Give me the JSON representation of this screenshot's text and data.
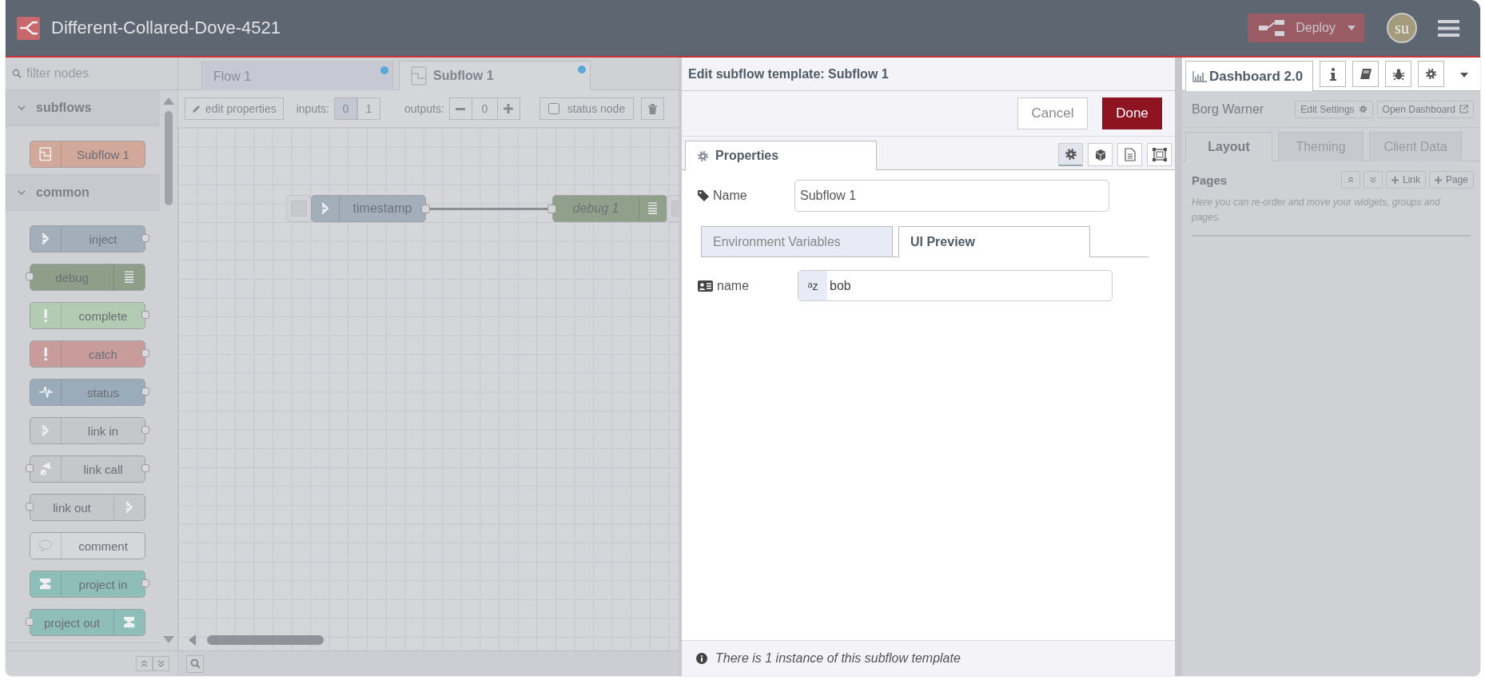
{
  "header": {
    "title": "Different-Collared-Dove-4521",
    "deploy": "Deploy",
    "user": "su"
  },
  "palette": {
    "filter": {
      "placeholder": "filter nodes"
    },
    "categories": [
      {
        "label": "subflows",
        "expanded": true,
        "nodes": [
          {
            "kind": "subflow",
            "label": "Subflow 1",
            "color": "#d2a89a",
            "input": false,
            "output": false
          }
        ]
      },
      {
        "label": "common",
        "expanded": true,
        "nodes": [
          {
            "kind": "inject",
            "label": "inject",
            "color": "#a3aebb",
            "input": false,
            "output": true
          },
          {
            "kind": "debug",
            "label": "debug",
            "color": "#8e9e89",
            "input": true,
            "output": false
          },
          {
            "kind": "complete",
            "label": "complete",
            "color": "#b4cbb3",
            "input": false,
            "output": true
          },
          {
            "kind": "catch",
            "label": "catch",
            "color": "#c99c9c",
            "input": false,
            "output": true
          },
          {
            "kind": "status",
            "label": "status",
            "color": "#9aabb9",
            "input": false,
            "output": true
          },
          {
            "kind": "linkin",
            "label": "link in",
            "color": "#c6c7cb",
            "input": false,
            "output": true
          },
          {
            "kind": "linkcall",
            "label": "link call",
            "color": "#c6c7cb",
            "input": true,
            "output": true
          },
          {
            "kind": "linkout",
            "label": "link out",
            "color": "#c6c7cb",
            "input": true,
            "output": false
          },
          {
            "kind": "comment",
            "label": "comment",
            "color": "#d6d7db",
            "input": false,
            "output": false
          },
          {
            "kind": "projectin",
            "label": "project in",
            "color": "#8fbdb8",
            "input": false,
            "output": true
          },
          {
            "kind": "projectout",
            "label": "project out",
            "color": "#8fbdb8",
            "input": true,
            "output": false
          }
        ]
      }
    ]
  },
  "workspace": {
    "tabs": [
      {
        "kind": "flow",
        "label": "Flow 1",
        "selected": false,
        "changed": true
      },
      {
        "kind": "subflow",
        "label": "Subflow 1",
        "selected": true,
        "changed": true
      }
    ],
    "toolbar": {
      "edit_button": "edit properties",
      "inputs_label": "inputs:",
      "inputs": [
        {
          "label": "0",
          "selected": true
        },
        {
          "label": "1",
          "selected": false
        }
      ],
      "outputs_label": "outputs:",
      "outputs_value": "0",
      "status_node": {
        "label": "status node",
        "checked": false
      }
    },
    "nodes": [
      {
        "kind": "inject",
        "label": "timestamp",
        "italic": false
      },
      {
        "kind": "debug",
        "label": "debug 1",
        "italic": true
      }
    ]
  },
  "tray": {
    "title": "Edit subflow template: Subflow 1",
    "cancel": "Cancel",
    "done": "Done",
    "tabs": [
      {
        "label": "Properties",
        "selected": true
      }
    ],
    "tab_icons": [
      {
        "kind": "settings",
        "selected": true
      },
      {
        "kind": "appearance",
        "selected": false
      },
      {
        "kind": "description",
        "selected": false
      },
      {
        "kind": "frame",
        "selected": false
      }
    ],
    "name_field": {
      "label": "Name",
      "value": "Subflow 1"
    },
    "subtabs": [
      {
        "label": "Environment Variables",
        "selected": false
      },
      {
        "label": "UI Preview",
        "selected": true
      }
    ],
    "preview_fields": [
      {
        "label": "name",
        "type_label": "$^{a}$z",
        "value": "bob"
      }
    ],
    "footer": "There is 1 instance of this subflow template"
  },
  "sidebar": {
    "tabs": [
      {
        "label": "Dashboard 2.0",
        "selected": true
      }
    ],
    "tab_icons": [
      {
        "kind": "info"
      },
      {
        "kind": "book"
      },
      {
        "kind": "debug"
      },
      {
        "kind": "settings"
      }
    ],
    "dashboard": {
      "name": "Borg Warner",
      "edit_settings": "Edit Settings",
      "open_dashboard": "Open Dashboard",
      "tabs": [
        {
          "label": "Layout",
          "selected": true
        },
        {
          "label": "Theming",
          "selected": false
        },
        {
          "label": "Client Data",
          "selected": false
        }
      ],
      "section_title": "Pages",
      "link_button": "Link",
      "page_button": "Page",
      "hint": "Here you can re-order and move your widgets, groups and pages."
    }
  }
}
